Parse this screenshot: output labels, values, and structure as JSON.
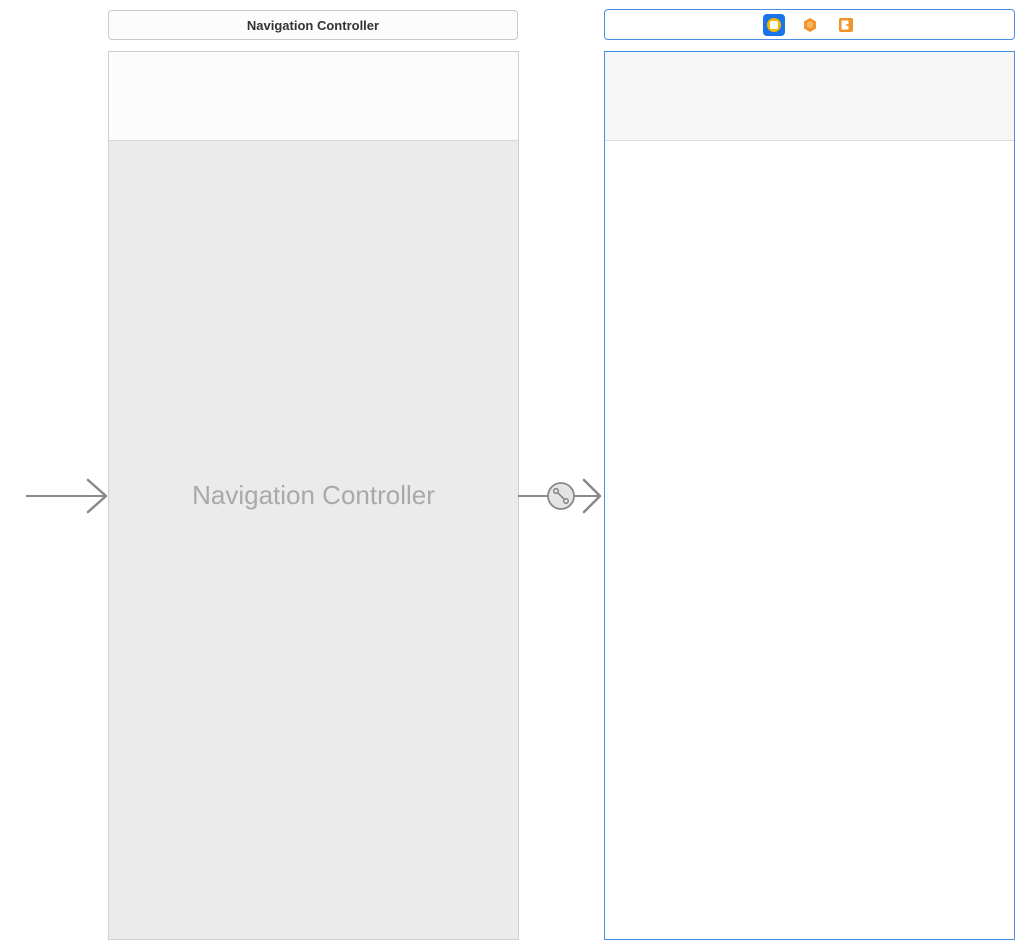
{
  "navigation_controller": {
    "title": "Navigation Controller",
    "placeholder": "Navigation Controller"
  },
  "view_controller": {
    "dock_icons": [
      {
        "name": "view-controller-icon",
        "color": "#f5b800",
        "selected": true
      },
      {
        "name": "first-responder-icon",
        "color": "#f0932b",
        "selected": false
      },
      {
        "name": "exit-icon",
        "color": "#f0932b",
        "selected": false
      }
    ]
  },
  "colors": {
    "selection_blue": "#4a90e2",
    "dock_selected": "#1a73e8",
    "nav_background": "#ebebeb",
    "arrow_gray": "#8a8a8a"
  }
}
